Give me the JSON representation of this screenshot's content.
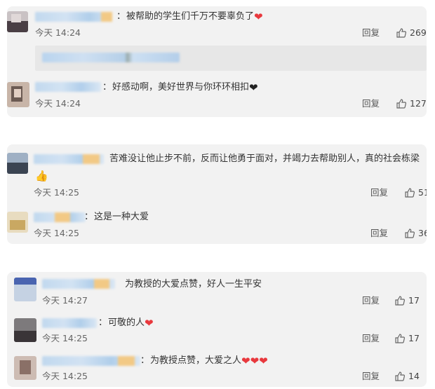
{
  "comments": [
    {
      "text": "被帮助的学生们千万不要辜负了",
      "hearts": 1,
      "heart_color": "#e8383d",
      "time": "今天 14:24",
      "reply": "回复",
      "likes": "269"
    },
    {
      "text": "好感动啊，美好世界与你环环相扣",
      "hearts": 1,
      "heart_color": "#222222",
      "time": "今天 14:24",
      "reply": "回复",
      "likes": "127"
    },
    {
      "text": "苦难没让他止步不前，反而让他勇于面对，并竭力去帮助别人，真的社会栋梁",
      "emoji": "👍",
      "time": "今天 14:25",
      "reply": "回复",
      "likes": "51"
    },
    {
      "text": "这是一种大爱",
      "time": "今天 14:25",
      "reply": "回复",
      "likes": "36"
    },
    {
      "text": "为教授的大爱点赞，好人一生平安",
      "time": "今天 14:27",
      "reply": "回复",
      "likes": "17"
    },
    {
      "text": "可敬的人",
      "hearts": 1,
      "heart_color": "#e8383d",
      "time": "今天 14:25",
      "reply": "回复",
      "likes": "17"
    },
    {
      "text": "为教授点赞，大爱之人",
      "hearts": 3,
      "heart_color": "#e8383d",
      "time": "今天 14:25",
      "reply": "回复",
      "likes": "14"
    }
  ],
  "colon": "：",
  "icons": {
    "like": "thumbs-up-icon",
    "heart": "heart-icon"
  },
  "colors": {
    "card_bg": "#f2f2f2",
    "heart_red": "#e8383d"
  }
}
